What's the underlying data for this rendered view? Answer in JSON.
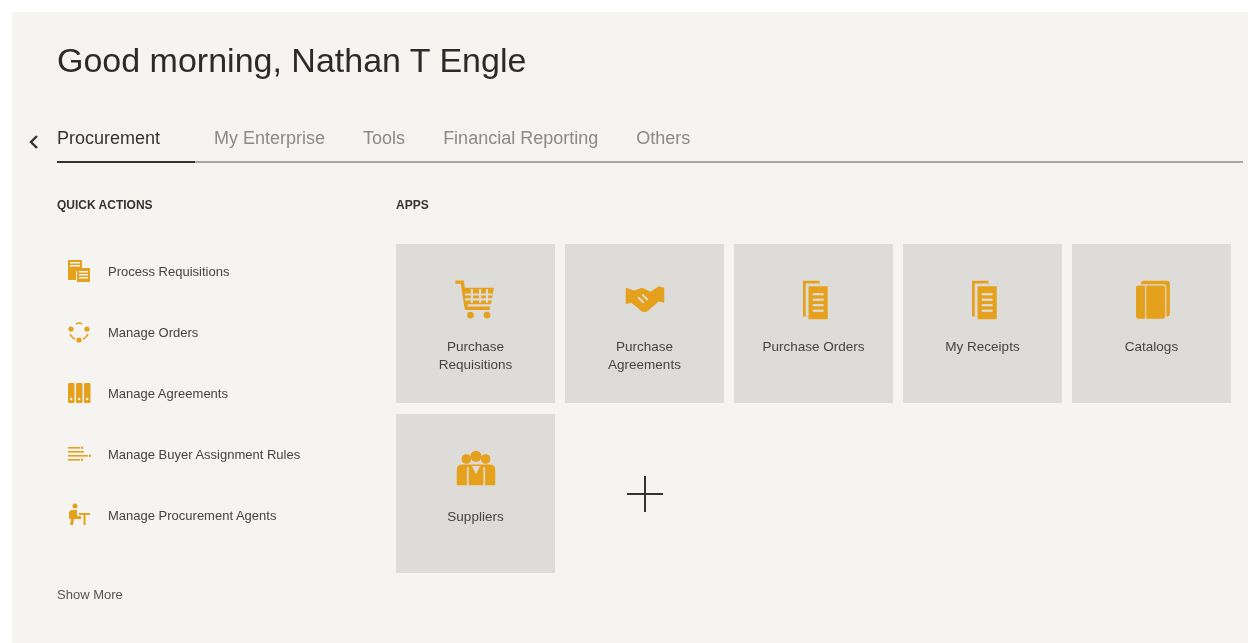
{
  "greeting": "Good morning, Nathan T Engle",
  "tabs": [
    {
      "label": "Procurement",
      "selected": true
    },
    {
      "label": "My Enterprise",
      "selected": false
    },
    {
      "label": "Tools",
      "selected": false
    },
    {
      "label": "Financial Reporting",
      "selected": false
    },
    {
      "label": "Others",
      "selected": false
    }
  ],
  "quick_actions": {
    "heading": "QUICK ACTIONS",
    "items": [
      "Process Requisitions",
      "Manage Orders",
      "Manage Agreements",
      "Manage Buyer Assignment Rules",
      "Manage Procurement Agents"
    ],
    "show_more": "Show More"
  },
  "apps": {
    "heading": "APPS",
    "tiles": [
      {
        "kind": "app",
        "label": "Purchase Requisitions"
      },
      {
        "kind": "app",
        "label": "Purchase Agreements"
      },
      {
        "kind": "app",
        "label": "Purchase Orders"
      },
      {
        "kind": "app",
        "label": "My Receipts"
      },
      {
        "kind": "app",
        "label": "Catalogs"
      },
      {
        "kind": "app",
        "label": "Suppliers"
      },
      {
        "kind": "add"
      }
    ]
  }
}
